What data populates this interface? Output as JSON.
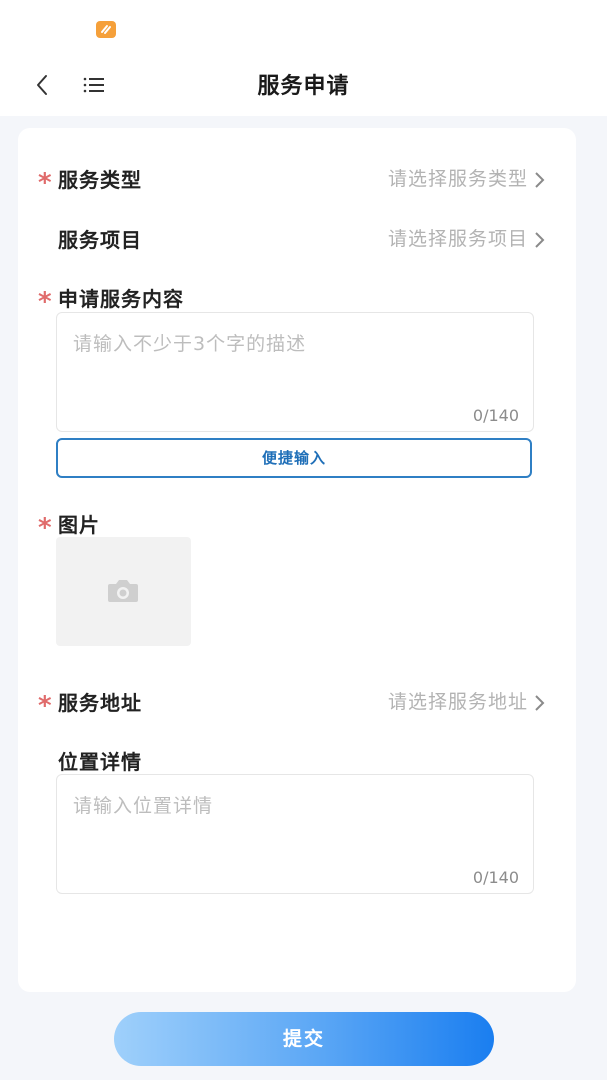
{
  "header": {
    "title": "服务申请",
    "back_icon": "chevron-left-icon",
    "menu_icon": "list-menu-icon",
    "app_badge_icon": "app-logo-icon"
  },
  "form": {
    "required_mark": "*",
    "service_type": {
      "label": "服务类型",
      "placeholder": "请选择服务类型",
      "required": true
    },
    "service_item": {
      "label": "服务项目",
      "placeholder": "请选择服务项目",
      "required": false
    },
    "service_content": {
      "label": "申请服务内容",
      "placeholder": "请输入不少于3个字的描述",
      "counter": "0/140",
      "required": true
    },
    "quick_input_label": "便捷输入",
    "images": {
      "label": "图片",
      "upload_icon": "camera-icon",
      "required": true
    },
    "service_address": {
      "label": "服务地址",
      "placeholder": "请选择服务地址",
      "required": true
    },
    "location_detail": {
      "label": "位置详情",
      "placeholder": "请输入位置详情",
      "counter": "0/140",
      "required": false
    }
  },
  "footer": {
    "submit_label": "提交"
  },
  "colors": {
    "required": "#e06b6b",
    "accent": "#2f7fc4",
    "submit_gradient_start": "#9fd0fb",
    "submit_gradient_end": "#1a7ef0"
  }
}
